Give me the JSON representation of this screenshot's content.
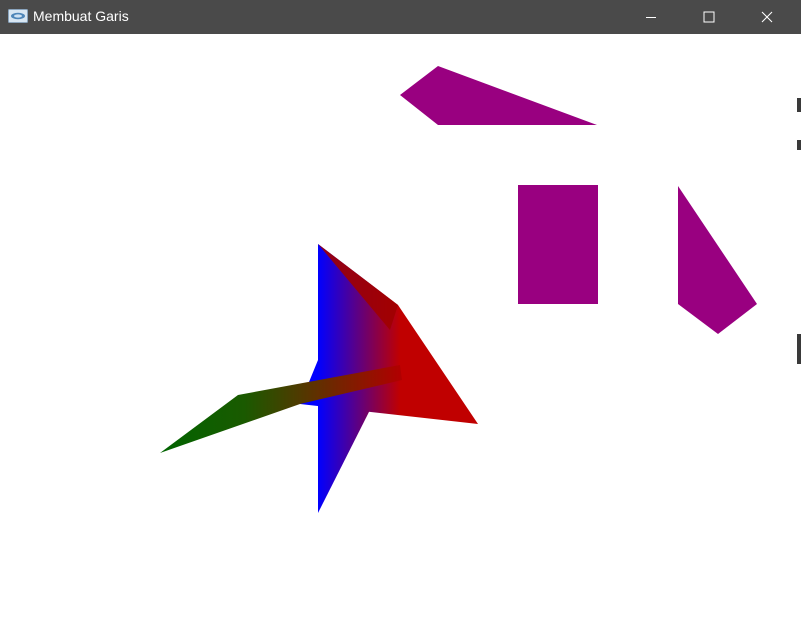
{
  "window": {
    "title": "Membuat Garis",
    "controls": {
      "minimize_icon": "minimize-icon",
      "maximize_icon": "maximize-icon",
      "close_icon": "close-icon"
    }
  },
  "colors": {
    "titlebar": "#4a4a4a",
    "canvas_bg": "#ffffff",
    "purple": "#990080",
    "blue": "#0000ff",
    "red": "#c00000",
    "green": "#006400"
  }
}
